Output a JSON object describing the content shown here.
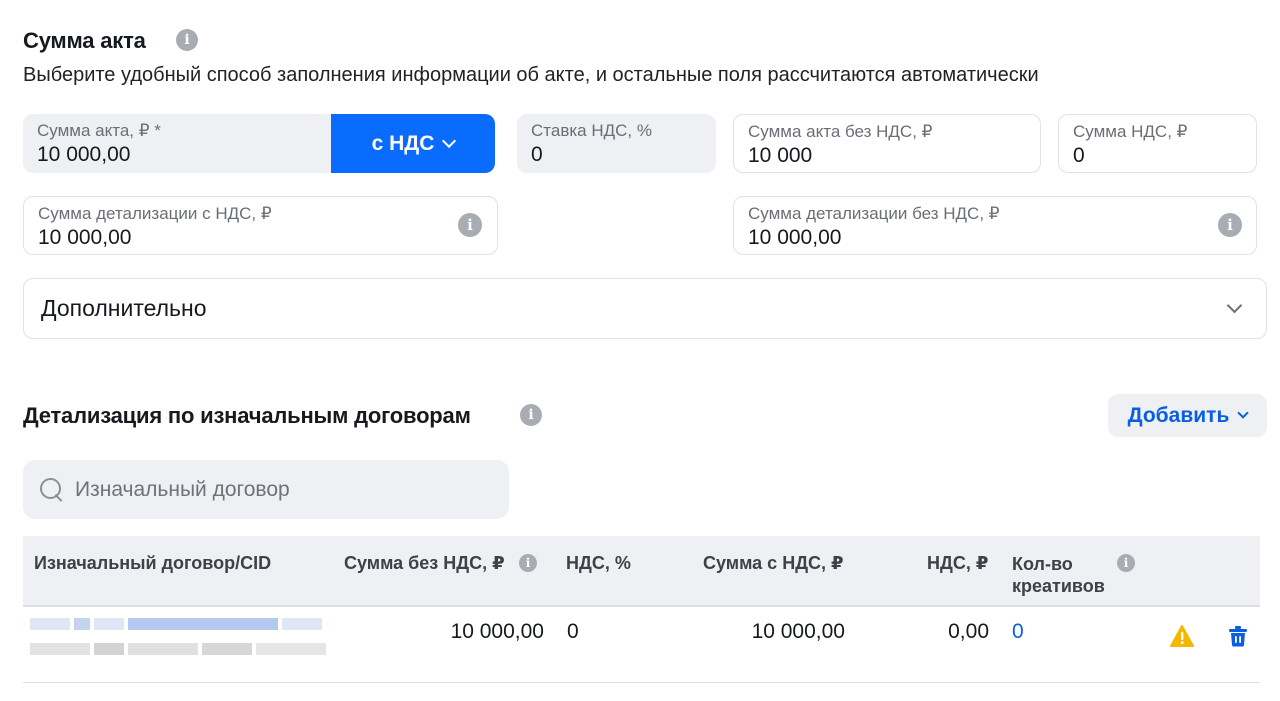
{
  "section1": {
    "title": "Сумма акта",
    "subtitle": "Выберите удобный способ заполнения информации об акте, и остальные поля рассчитаются автоматически"
  },
  "fields": {
    "act_sum": {
      "label": "Сумма акта, ₽ *",
      "value": "10 000,00"
    },
    "vat_mode": {
      "label": "с НДС"
    },
    "vat_rate": {
      "label": "Ставка НДС, %",
      "value": "0"
    },
    "act_sum_no_vat": {
      "label": "Сумма акта без НДС, ₽",
      "value": "10 000"
    },
    "vat_sum": {
      "label": "Сумма НДС, ₽",
      "value": "0"
    },
    "detail_with_vat": {
      "label": "Сумма детализации с НДС, ₽",
      "value": "10 000,00"
    },
    "detail_no_vat": {
      "label": "Сумма детализации без НДС, ₽",
      "value": "10 000,00"
    }
  },
  "additional": {
    "title": "Дополнительно"
  },
  "section2": {
    "title": "Детализация по изначальным договорам",
    "add_label": "Добавить"
  },
  "search": {
    "placeholder": "Изначальный договор"
  },
  "table": {
    "headers": {
      "contract": "Изначальный договор/CID",
      "sum_no_vat": "Сумма без НДС, ₽",
      "vat_pct": "НДС, %",
      "sum_with_vat": "Сумма с НДС, ₽",
      "vat_rub": "НДС, ₽",
      "creatives": "Кол-во креативов"
    },
    "rows": [
      {
        "sum_no_vat": "10 000,00",
        "vat_pct": "0",
        "sum_with_vat": "10 000,00",
        "vat_rub": "0,00",
        "creatives": "0"
      }
    ]
  },
  "icons": {
    "info": "info-icon",
    "chevron": "chevron-down-icon",
    "search": "search-icon",
    "warning": "warning-icon",
    "delete": "trash-icon"
  },
  "colors": {
    "accent": "#0a6cff",
    "link": "#0a5fe0",
    "field_bg": "#eef0f3",
    "warning": "#f5b800"
  }
}
